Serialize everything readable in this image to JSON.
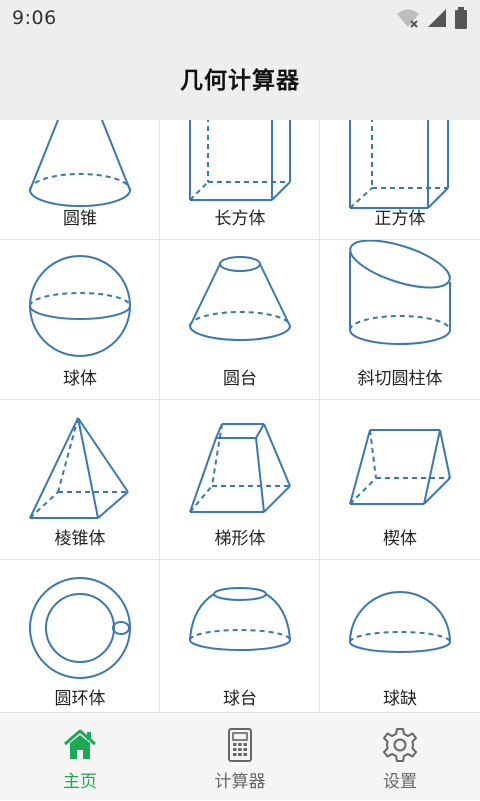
{
  "status_bar": {
    "time": "9:06"
  },
  "app_bar": {
    "title": "几何计算器"
  },
  "shapes": [
    {
      "label": "圆锥"
    },
    {
      "label": "长方体"
    },
    {
      "label": "正方体"
    },
    {
      "label": "球体"
    },
    {
      "label": "圆台"
    },
    {
      "label": "斜切圆柱体"
    },
    {
      "label": "棱锥体"
    },
    {
      "label": "梯形体"
    },
    {
      "label": "楔体"
    },
    {
      "label": "圆环体"
    },
    {
      "label": "球台"
    },
    {
      "label": "球缺"
    }
  ],
  "bottom_nav": {
    "items": [
      {
        "label": "主页",
        "icon": "home-icon",
        "active": true
      },
      {
        "label": "计算器",
        "icon": "calculator-icon",
        "active": false
      },
      {
        "label": "设置",
        "icon": "gear-icon",
        "active": false
      }
    ]
  },
  "colors": {
    "shape_stroke": "#3a78b0",
    "active_nav": "#1aaa55",
    "inactive_nav": "#666666",
    "bar_bg": "#eeeeee"
  }
}
